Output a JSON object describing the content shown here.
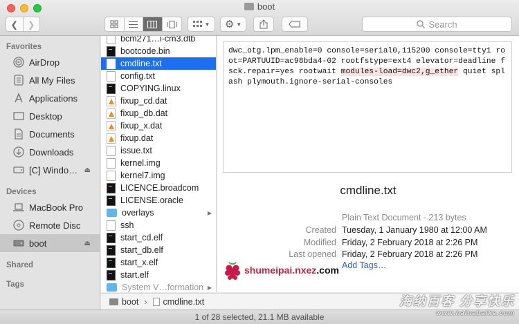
{
  "window": {
    "title": "boot"
  },
  "toolbar": {
    "search_placeholder": "Search"
  },
  "sidebar": {
    "favorites_header": "Favorites",
    "favorites": [
      {
        "label": "AirDrop",
        "icon": "airdrop-icon"
      },
      {
        "label": "All My Files",
        "icon": "all-files-icon"
      },
      {
        "label": "Applications",
        "icon": "applications-icon"
      },
      {
        "label": "Desktop",
        "icon": "desktop-icon"
      },
      {
        "label": "Documents",
        "icon": "documents-icon"
      },
      {
        "label": "Downloads",
        "icon": "downloads-icon"
      },
      {
        "label": "[C] Windo…",
        "icon": "network-drive-icon"
      }
    ],
    "devices_header": "Devices",
    "devices": [
      {
        "label": "MacBook Pro",
        "icon": "laptop-icon"
      },
      {
        "label": "Remote Disc",
        "icon": "disc-icon"
      },
      {
        "label": "boot",
        "icon": "drive-icon"
      }
    ],
    "shared_header": "Shared",
    "tags_header": "Tags"
  },
  "files": [
    {
      "name": "bcm271…i-cm3.dtb",
      "type": "doc"
    },
    {
      "name": "bootcode.bin",
      "type": "exec"
    },
    {
      "name": "cmdline.txt",
      "type": "doc"
    },
    {
      "name": "config.txt",
      "type": "doc"
    },
    {
      "name": "COPYING.linux",
      "type": "exec"
    },
    {
      "name": "fixup_cd.dat",
      "type": "vlc"
    },
    {
      "name": "fixup_db.dat",
      "type": "vlc"
    },
    {
      "name": "fixup_x.dat",
      "type": "vlc"
    },
    {
      "name": "fixup.dat",
      "type": "vlc"
    },
    {
      "name": "issue.txt",
      "type": "doc"
    },
    {
      "name": "kernel.img",
      "type": "doc"
    },
    {
      "name": "kernel7.img",
      "type": "doc"
    },
    {
      "name": "LICENCE.broadcom",
      "type": "exec"
    },
    {
      "name": "LICENSE.oracle",
      "type": "exec"
    },
    {
      "name": "overlays",
      "type": "folder"
    },
    {
      "name": "ssh",
      "type": "doc"
    },
    {
      "name": "start_cd.elf",
      "type": "exec"
    },
    {
      "name": "start_db.elf",
      "type": "exec"
    },
    {
      "name": "start_x.elf",
      "type": "exec"
    },
    {
      "name": "start.elf",
      "type": "exec"
    },
    {
      "name": "System V…formation",
      "type": "folder"
    }
  ],
  "preview": {
    "text_before": "dwc_otg.lpm_enable=0 console=serial0,115200 console=tty1 root=PARTUUID=ac98bda4-02 rootfstype=ext4 elevator=deadline fsck.repair=yes rootwait ",
    "text_highlight": "modules-load=dwc2,g_ether",
    "text_after": " quiet splash plymouth.ignore-serial-consoles",
    "filename": "cmdline.txt",
    "kind": "Plain Text Document - 213 bytes",
    "created_label": "Created",
    "created_value": "Tuesday, 1 January 1980 at 12:00 AM",
    "modified_label": "Modified",
    "modified_value": "Friday, 2 February 2018 at 2:26 PM",
    "opened_label": "Last opened",
    "opened_value": "Friday, 2 February 2018 at 2:26 PM",
    "add_tags": "Add Tags…"
  },
  "watermark": {
    "prefix": "shumeipai",
    "middle": ".nxez",
    "suffix": ".com",
    "site_cn": "海纳百客 分享快乐",
    "site_url": "www.hainabaike.com"
  },
  "pathbar": {
    "root": "boot",
    "separator": "›",
    "file": "cmdline.txt"
  },
  "status": "1 of 28 selected, 21.1 MB available",
  "colors": {
    "selection": "#1d6ff2",
    "link": "#2866d6",
    "highlight": "#fbe3e3"
  }
}
